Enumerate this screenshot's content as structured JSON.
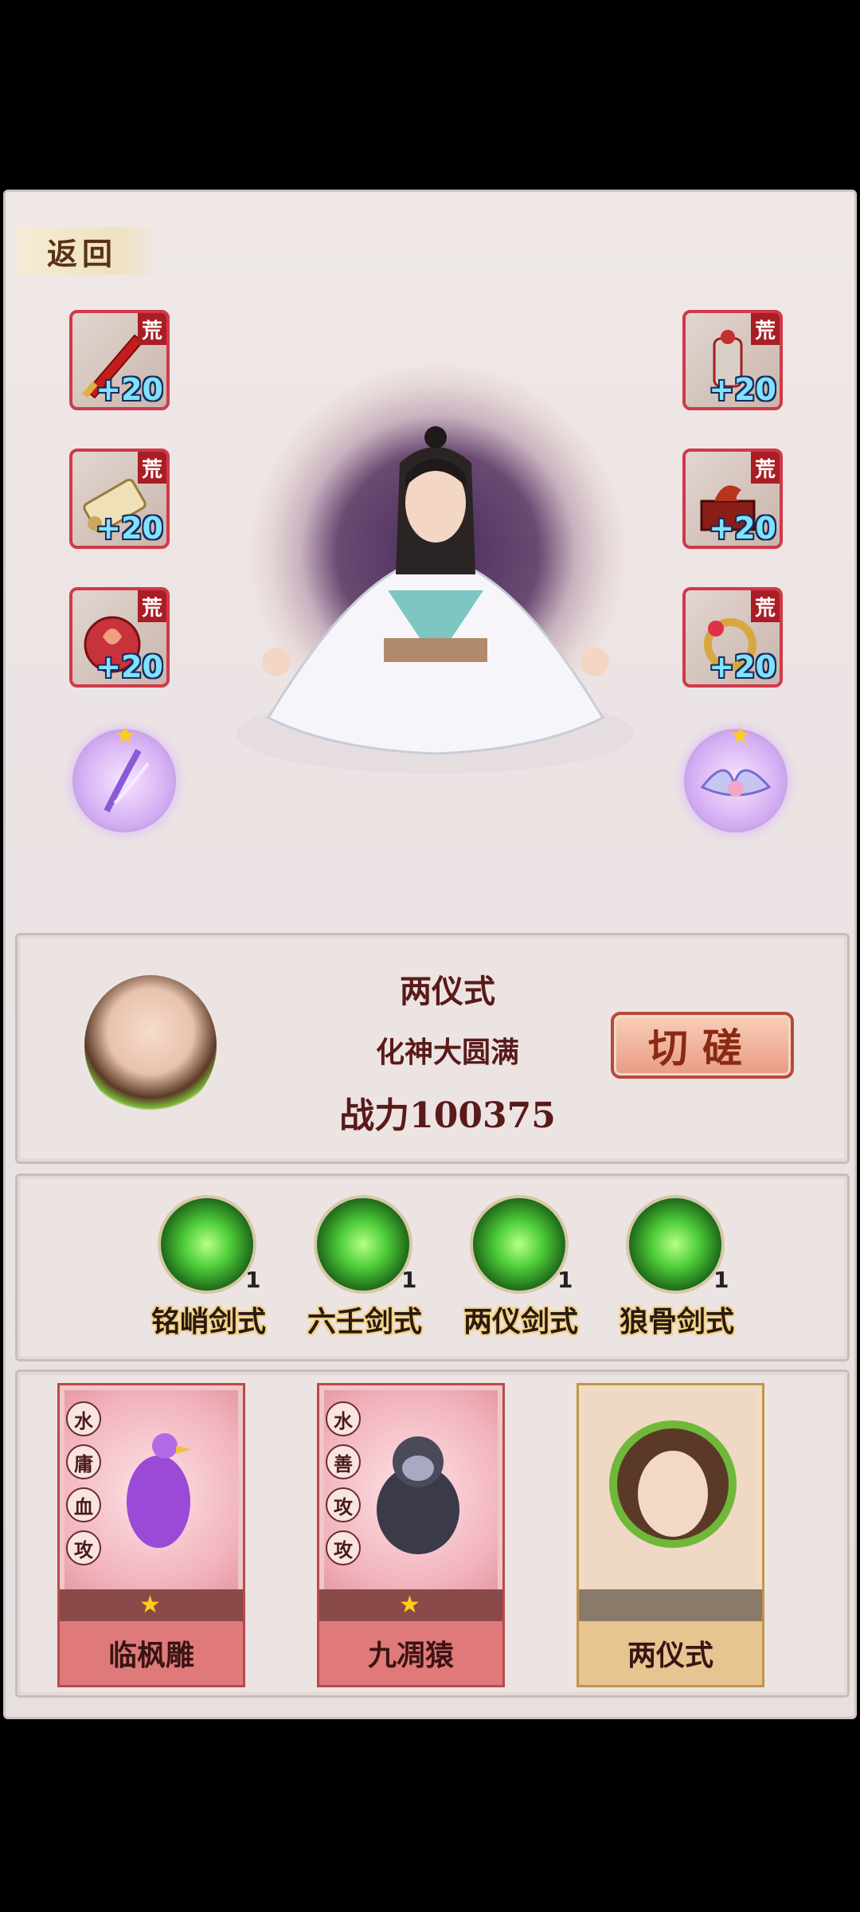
{
  "header": {
    "back_label": "返回"
  },
  "equipment": {
    "left": [
      {
        "icon": "red-sword-icon",
        "tag": "荒",
        "bonus": "+20"
      },
      {
        "icon": "scroll-icon",
        "tag": "荒",
        "bonus": "+20"
      },
      {
        "icon": "red-pouch-icon",
        "tag": "荒",
        "bonus": "+20"
      }
    ],
    "right": [
      {
        "icon": "armor-icon",
        "tag": "荒",
        "bonus": "+20"
      },
      {
        "icon": "treasure-chest-icon",
        "tag": "荒",
        "bonus": "+20"
      },
      {
        "icon": "ring-icon",
        "tag": "荒",
        "bonus": "+20"
      }
    ],
    "left_orb": {
      "icon": "feather-orb-icon",
      "stars": 1
    },
    "right_orb": {
      "icon": "wing-orb-icon",
      "stars": 1
    }
  },
  "info": {
    "name": "两仪式",
    "realm": "化神大圆满",
    "power": "战力100375",
    "duel_label": "切磋"
  },
  "skills": [
    {
      "name": "铭峭剑式",
      "level": "1"
    },
    {
      "name": "六壬剑式",
      "level": "1"
    },
    {
      "name": "两仪剑式",
      "level": "1"
    },
    {
      "name": "狼骨剑式",
      "level": "1"
    }
  ],
  "team": [
    {
      "name": "临枫雕",
      "attrs": [
        "水",
        "庸",
        "血",
        "攻"
      ],
      "stars": 1
    },
    {
      "name": "九凋猿",
      "attrs": [
        "水",
        "善",
        "攻",
        "攻"
      ],
      "stars": 1
    },
    {
      "name": "两仪式",
      "attrs": [],
      "stars": 0
    }
  ]
}
